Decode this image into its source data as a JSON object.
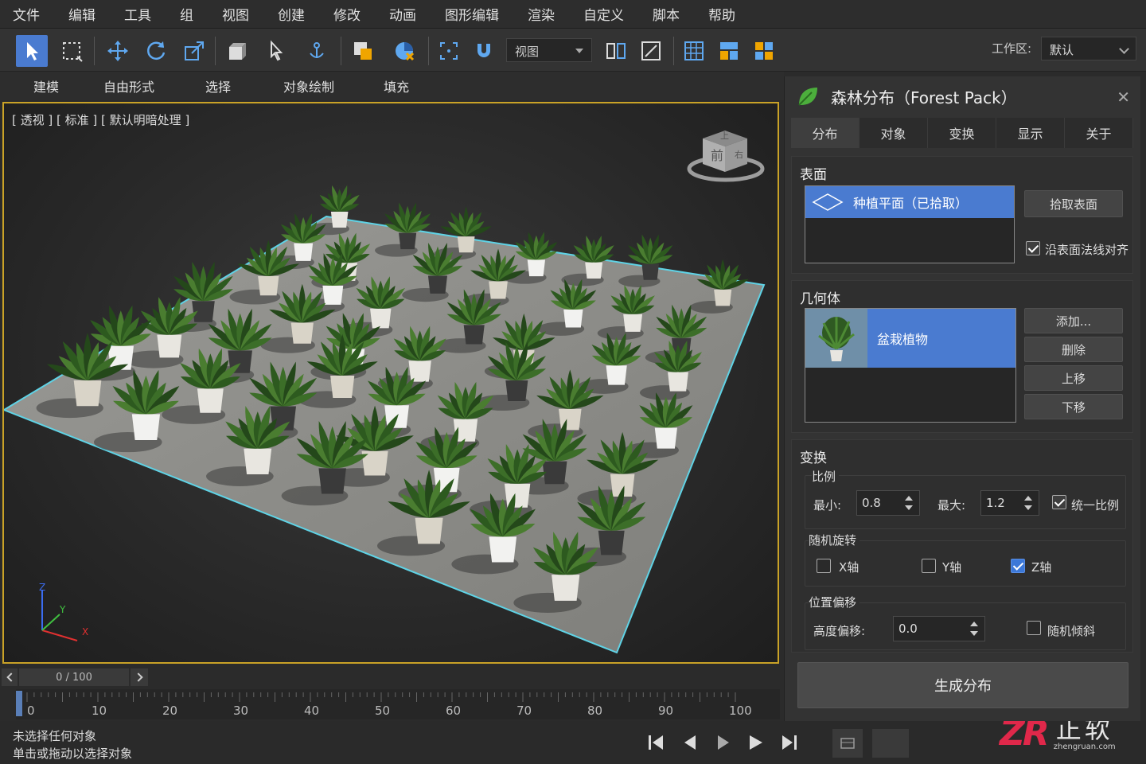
{
  "menu": [
    "文件",
    "编辑",
    "工具",
    "组",
    "视图",
    "创建",
    "修改",
    "动画",
    "图形编辑",
    "渲染",
    "自定义",
    "脚本",
    "帮助"
  ],
  "toolbar": {
    "view_dropdown": "视图",
    "workspace_label": "工作区:",
    "workspace_value": "默认"
  },
  "ribbon": [
    "建模",
    "自由形式",
    "选择",
    "对象绘制",
    "填充"
  ],
  "viewport": {
    "label": "[ 透视 ] [ 标准 ] [ 默认明暗处理 ]",
    "viewcube_front": "前",
    "viewcube_top": "上",
    "viewcube_right": "右",
    "axes": {
      "x": "X",
      "y": "Y",
      "z": "Z"
    }
  },
  "timeline": {
    "frame_display": "0 / 100",
    "ticks": [
      "0",
      "10",
      "20",
      "30",
      "40",
      "50",
      "60",
      "70",
      "80",
      "90",
      "100"
    ]
  },
  "status": {
    "line1": "未选择任何对象",
    "line2": "单击或拖动以选择对象"
  },
  "panel": {
    "title": "森林分布（Forest Pack）",
    "tabs": [
      "分布",
      "对象",
      "变换",
      "显示",
      "关于"
    ],
    "surface": {
      "title": "表面",
      "item": "种植平面（已拾取）",
      "pick_button": "拾取表面",
      "align_label": "沿表面法线对齐",
      "align_checked": true
    },
    "geometry": {
      "title": "几何体",
      "item": "盆栽植物",
      "buttons": [
        "添加...",
        "删除",
        "上移",
        "下移"
      ]
    },
    "transform": {
      "title": "变换",
      "scale_title": "比例",
      "min_label": "最小:",
      "min_value": "0.8",
      "max_label": "最大:",
      "max_value": "1.2",
      "uniform_label": "统一比例",
      "uniform_checked": true,
      "rotation_title": "随机旋转",
      "x_axis": "X轴",
      "y_axis": "Y轴",
      "z_axis": "Z轴",
      "x_checked": false,
      "y_checked": false,
      "z_checked": true,
      "offset_title": "位置偏移",
      "height_label": "高度偏移:",
      "height_value": "0.0",
      "tilt_label": "随机倾斜",
      "tilt_checked": false
    },
    "generate_button": "生成分布"
  },
  "logo": {
    "mark": "ZR",
    "name": "正软",
    "url": "zhengruan.com"
  },
  "colors": {
    "accent": "#4a7bd0",
    "viewport_border": "#c9a227",
    "plane_edge": "#5fd3e6",
    "logo": "#e0284a"
  }
}
